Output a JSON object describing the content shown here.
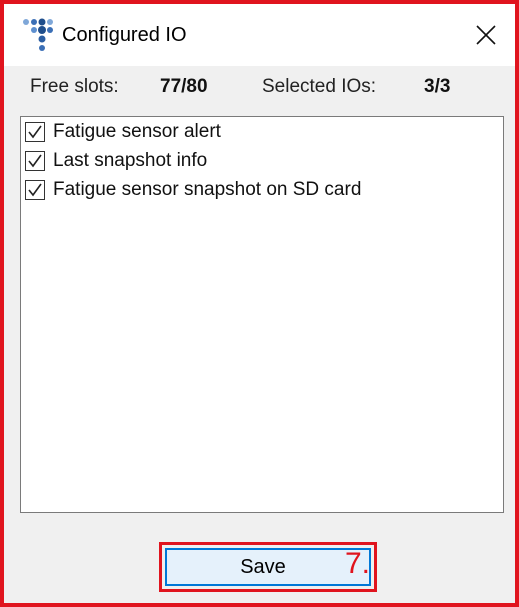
{
  "window": {
    "title": "Configured IO",
    "app_icon": "dots-logo-icon",
    "close_icon": "close-icon"
  },
  "stats": {
    "free_slots_label": "Free slots:",
    "free_slots_value": "77/80",
    "selected_label": "Selected IOs:",
    "selected_value": "3/3"
  },
  "io_list": {
    "items": [
      {
        "label": "Fatigue sensor alert",
        "checked": true
      },
      {
        "label": "Last snapshot info",
        "checked": true
      },
      {
        "label": "Fatigue sensor snapshot on SD card",
        "checked": true
      }
    ]
  },
  "footer": {
    "save_label": "Save",
    "step_marker": "7."
  },
  "colors": {
    "highlight": "#e0141e",
    "button_border": "#0078d7",
    "button_fill": "#e5f1fb",
    "logo_blue": "#1f4e8c"
  }
}
